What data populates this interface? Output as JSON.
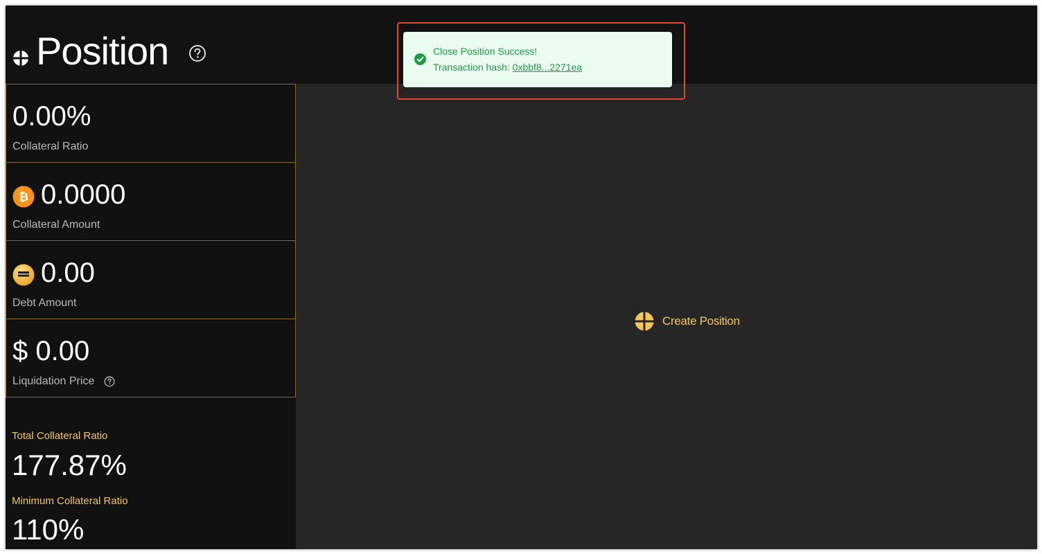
{
  "header": {
    "title": "Position",
    "logo_icon": "crosshair-logo-icon",
    "help_icon": "help-circle-icon"
  },
  "stats": {
    "collateral_ratio": {
      "value": "0.00%",
      "label": "Collateral Ratio"
    },
    "collateral_amount": {
      "value": "0.0000",
      "label": "Collateral Amount",
      "icon": "bitcoin-icon"
    },
    "debt_amount": {
      "value": "0.00",
      "label": "Debt Amount",
      "icon": "stablecoin-icon"
    },
    "liquidation_price": {
      "value": "$ 0.00",
      "label": "Liquidation Price",
      "icon": "help-circle-icon"
    }
  },
  "summary": {
    "total_label": "Total Collateral Ratio",
    "total_value": "177.87%",
    "minimum_label": "Minimum Collateral Ratio",
    "minimum_value": "110%"
  },
  "main": {
    "create_label": "Create Position",
    "create_icon": "crosshair-plus-icon"
  },
  "toast": {
    "title": "Close Position Success!",
    "hash_prefix": "Transaction hash: ",
    "hash_link": "0xbbf8...2271ea",
    "icon": "check-circle-icon"
  },
  "colors": {
    "accent": "#f2c75c",
    "border": "#8a6d22",
    "background": "#121212",
    "panel": "#262626",
    "success": "#1f9b44",
    "toast_bg": "#eafbf0",
    "highlight": "#e04a2a"
  }
}
